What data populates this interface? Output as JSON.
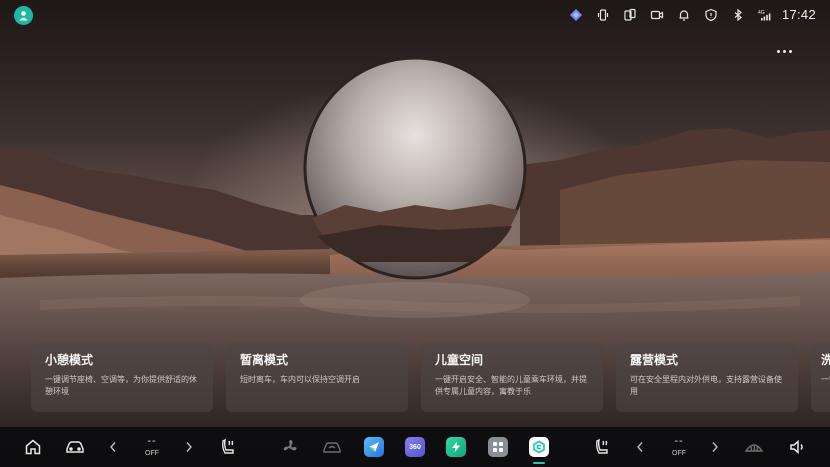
{
  "status_bar": {
    "icons": [
      "avatar-icon",
      "assistant-icon",
      "phone-vibrate-icon",
      "screen-mirror-icon",
      "camera-icon",
      "notification-bell-icon",
      "shield-icon",
      "bluetooth-icon",
      "signal-4g-icon"
    ],
    "network": "4G",
    "time": "17:42",
    "more_icon": "more-horizontal-icon"
  },
  "cards": [
    {
      "title": "小憩模式",
      "desc": "一键调节座椅、空调等，为你提供舒适的休憩环境"
    },
    {
      "title": "暂离模式",
      "desc": "短时离车，车内可以保持空调开启"
    },
    {
      "title": "儿童空间",
      "desc": "一键开启安全、智能的儿童乘车环境，并提供专属儿童内容，寓教于乐"
    },
    {
      "title": "露营模式",
      "desc": "可在安全里程内对外供电，支持露营设备使用"
    },
    {
      "title": "洗",
      "desc": "一键"
    }
  ],
  "dock": {
    "left_temp": {
      "value": "--",
      "state": "OFF"
    },
    "right_temp": {
      "value": "--",
      "state": "OFF"
    },
    "apps": [
      {
        "name": "navigation-app-icon",
        "color": "#3a8fe0"
      },
      {
        "name": "camera-360-app-icon",
        "label": "360",
        "color": "#6a64d6"
      },
      {
        "name": "energy-app-icon",
        "color": "#1fbf8f"
      },
      {
        "name": "app-grid-icon",
        "color": "#8a8e96"
      },
      {
        "name": "scene-mode-app-icon",
        "color": "#20c1b1"
      }
    ]
  },
  "colors": {
    "accent": "#20c1b1",
    "card_bg": "rgba(78,70,68,0.62)",
    "dock_bg": "#0c0c0e"
  }
}
